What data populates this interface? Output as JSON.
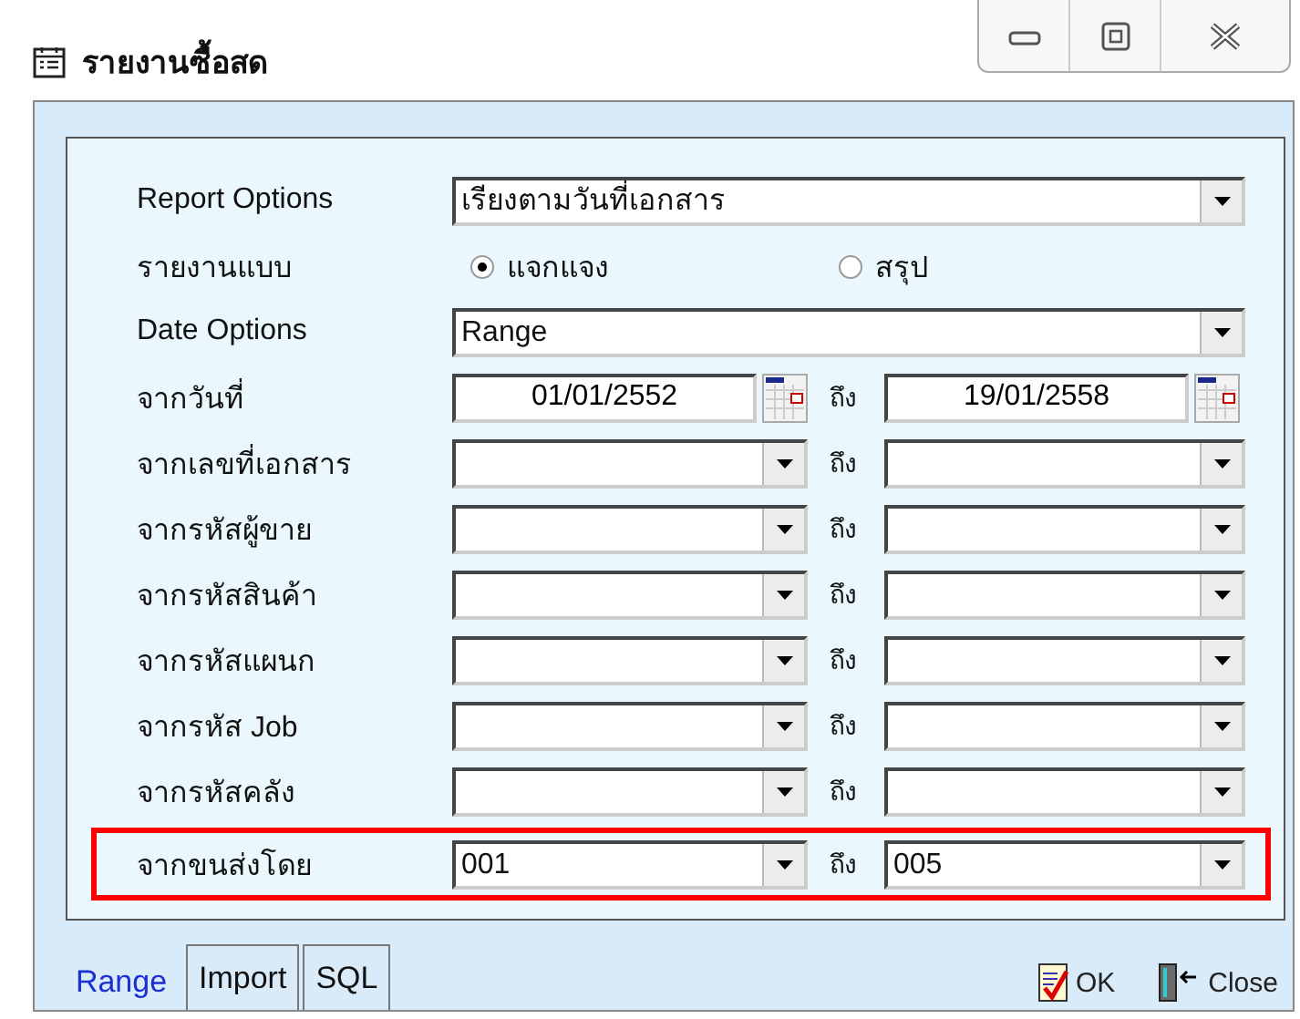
{
  "window": {
    "title": "รายงานซื้อสด"
  },
  "rows": [
    {
      "kind": "combo",
      "label": "Report Options",
      "value": "เรียงตามวันที่เอกสาร",
      "highlighted": false
    },
    {
      "kind": "radio",
      "label": "รายงานแบบ",
      "options": [
        {
          "label": "แจกแจง",
          "selected": true
        },
        {
          "label": "สรุป",
          "selected": false
        }
      ],
      "highlighted": false
    },
    {
      "kind": "combo",
      "label": "Date Options",
      "value": "Range",
      "highlighted": false
    },
    {
      "kind": "date_range",
      "label": "จากวันที่",
      "from": "01/01/2552",
      "to_label": "ถึง",
      "to": "19/01/2558",
      "highlighted": false
    },
    {
      "kind": "combo_range",
      "label": "จากเลขที่เอกสาร",
      "to_label": "ถึง",
      "highlighted": false
    },
    {
      "kind": "combo_range",
      "label": "จากรหัสผู้ขาย",
      "to_label": "ถึง",
      "highlighted": false
    },
    {
      "kind": "combo_range",
      "label": "จากรหัสสินค้า",
      "to_label": "ถึง",
      "highlighted": false
    },
    {
      "kind": "combo_range",
      "label": "จากรหัสแผนก",
      "to_label": "ถึง",
      "highlighted": false
    },
    {
      "kind": "combo_range",
      "label": "จากรหัส Job",
      "to_label": "ถึง",
      "highlighted": false
    },
    {
      "kind": "combo_range",
      "label": "จากรหัสคลัง",
      "to_label": "ถึง",
      "highlighted": false
    },
    {
      "kind": "combo_range",
      "label": "จากขนส่งโดย",
      "from": "001",
      "to_label": "ถึง",
      "to": "005",
      "highlighted": true
    }
  ],
  "tabs": [
    {
      "label": "Range",
      "selected": true
    },
    {
      "label": "Import",
      "selected": false
    },
    {
      "label": "SQL",
      "selected": false
    }
  ],
  "buttons": [
    {
      "kind": "ok",
      "label": "OK"
    },
    {
      "kind": "close",
      "label": "Close"
    }
  ]
}
